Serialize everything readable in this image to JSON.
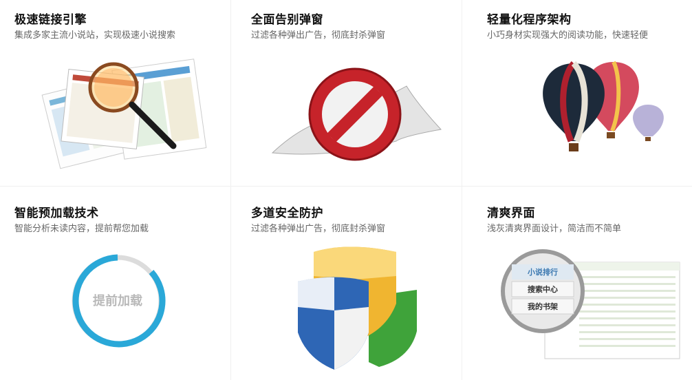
{
  "features": [
    {
      "title": "极速链接引擎",
      "desc": "集成多家主流小说站，实现极速小说搜索",
      "icon": "magnifier-icon"
    },
    {
      "title": "全面告别弹窗",
      "desc": "过滤各种弹出广告，彻底封杀弹窗",
      "icon": "no-popup-icon"
    },
    {
      "title": "轻量化程序架构",
      "desc": "小巧身材实现强大的阅读功能，快速轻便",
      "icon": "hot-air-balloon-icon"
    },
    {
      "title": "智能预加载技术",
      "desc": "智能分析未读内容，提前帮您加载",
      "icon": "preload-ring-icon",
      "ring_label": "提前加载"
    },
    {
      "title": "多道安全防护",
      "desc": "过滤各种弹出广告，彻底封杀弹窗",
      "icon": "shield-icon"
    },
    {
      "title": "清爽界面",
      "desc": "浅灰清爽界面设计，简洁而不简单",
      "icon": "interface-magnifier-icon",
      "menu": [
        "小说排行",
        "搜索中心",
        "我的书架"
      ]
    }
  ],
  "colors": {
    "title": "#111111",
    "desc": "#666666",
    "divider": "#f0f0f0"
  }
}
